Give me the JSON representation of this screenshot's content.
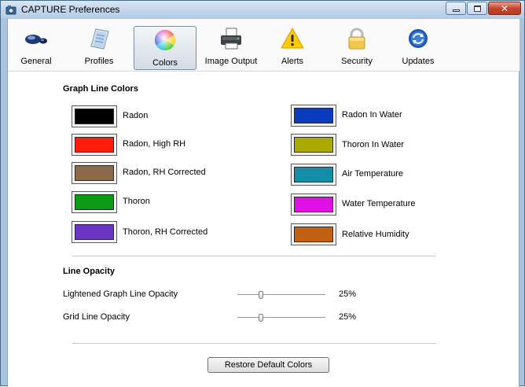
{
  "window": {
    "title": "CAPTURE Preferences"
  },
  "toolbar": {
    "tabs": [
      {
        "label": "General",
        "icon": "gears-icon"
      },
      {
        "label": "Profiles",
        "icon": "profile-document-icon"
      },
      {
        "label": "Colors",
        "icon": "color-wheel-icon",
        "selected": true
      },
      {
        "label": "Image Output",
        "icon": "printer-icon"
      },
      {
        "label": "Alerts",
        "icon": "warning-icon"
      },
      {
        "label": "Security",
        "icon": "padlock-icon"
      },
      {
        "label": "Updates",
        "icon": "sync-arrows-icon"
      }
    ]
  },
  "graph_line_colors": {
    "title": "Graph Line Colors",
    "left": [
      {
        "label": "Radon",
        "color": "#000000"
      },
      {
        "label": "Radon, High RH",
        "color": "#ff1a0a"
      },
      {
        "label": "Radon, RH Corrected",
        "color": "#8b6a49"
      },
      {
        "label": "Thoron",
        "color": "#0a9a16"
      },
      {
        "label": "Thoron, RH Corrected",
        "color": "#6a35c3"
      }
    ],
    "right": [
      {
        "label": "Radon In Water",
        "color": "#0a3bbd"
      },
      {
        "label": "Thoron In Water",
        "color": "#aaaa00"
      },
      {
        "label": "Air Temperature",
        "color": "#128ea8"
      },
      {
        "label": "Water Temperature",
        "color": "#e010e6"
      },
      {
        "label": "Relative Humidity",
        "color": "#c06010"
      }
    ]
  },
  "line_opacity": {
    "title": "Line Opacity",
    "rows": [
      {
        "label": "Lightened Graph Line Opacity",
        "value": "25%",
        "level": 0.25
      },
      {
        "label": "Grid Line Opacity",
        "value": "25%",
        "level": 0.25
      }
    ]
  },
  "footer": {
    "restore_label": "Restore Default Colors"
  }
}
